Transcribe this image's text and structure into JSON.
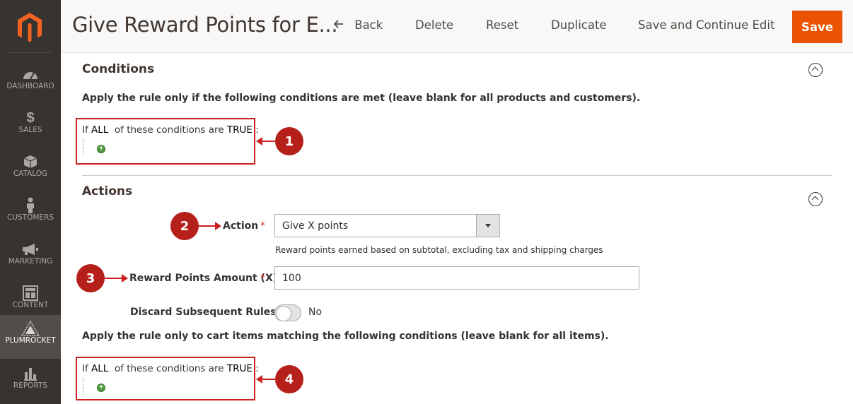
{
  "sidebar": {
    "logo_icon": "magento-logo-icon",
    "items": [
      {
        "label": "DASHBOARD",
        "icon": "gauge-icon"
      },
      {
        "label": "SALES",
        "icon": "dollar-icon"
      },
      {
        "label": "CATALOG",
        "icon": "box-icon"
      },
      {
        "label": "CUSTOMERS",
        "icon": "person-icon"
      },
      {
        "label": "MARKETING",
        "icon": "megaphone-icon"
      },
      {
        "label": "CONTENT",
        "icon": "layout-icon"
      },
      {
        "label": "PLUMROCKET",
        "icon": "plumrocket-icon",
        "active": true
      },
      {
        "label": "REPORTS",
        "icon": "bar-chart-icon"
      }
    ]
  },
  "header": {
    "title": "Give Reward Points for E...",
    "back_label": "Back",
    "delete_label": "Delete",
    "reset_label": "Reset",
    "duplicate_label": "Duplicate",
    "save_continue_label": "Save and Continue Edit",
    "save_label": "Save"
  },
  "conditions": {
    "title": "Conditions",
    "help": "Apply the rule only if the following conditions are met (leave blank for all products and customers).",
    "rule": {
      "prefix": "If",
      "aggregator": "ALL",
      "middle": "of these conditions are",
      "value": "TRUE",
      "suffix": ":"
    }
  },
  "actions": {
    "title": "Actions",
    "action_label": "Action",
    "action_value": "Give X points",
    "action_note": "Reward points earned based on subtotal, excluding tax and shipping charges",
    "amount_label": "Reward Points Amount (X)",
    "amount_value": "100",
    "discard_label": "Discard Subsequent Rules",
    "discard_value": "No",
    "cart_help": "Apply the rule only to cart items matching the following conditions (leave blank for all items).",
    "rule": {
      "prefix": "If",
      "aggregator": "ALL",
      "middle": "of these conditions are",
      "value": "TRUE",
      "suffix": ":"
    }
  },
  "callouts": [
    "1",
    "2",
    "3",
    "4"
  ],
  "colors": {
    "accent": "#eb5202",
    "callout": "#b5201a",
    "sidebar": "#373330"
  }
}
